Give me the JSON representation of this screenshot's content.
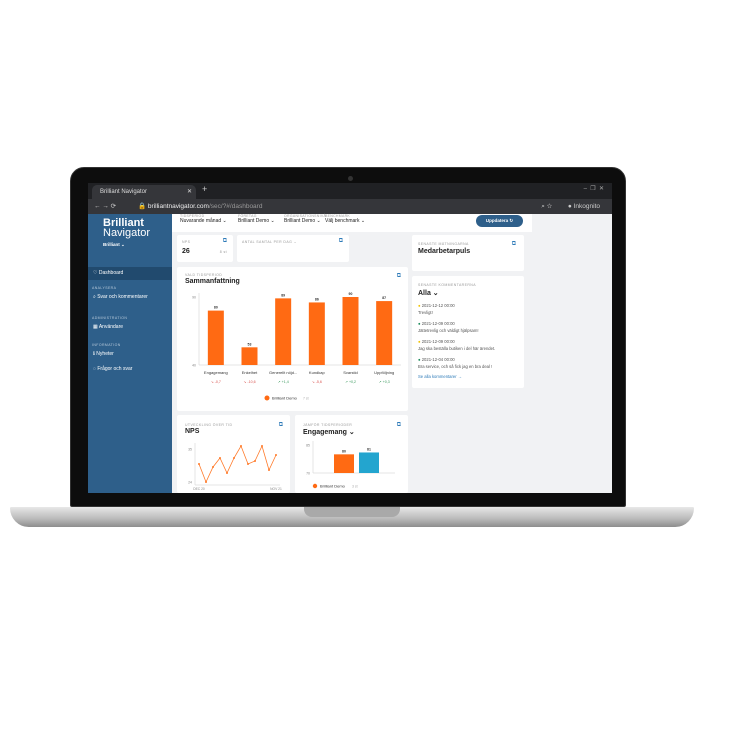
{
  "browser": {
    "tab_title": "Brilliant Navigator",
    "new_tab": "+",
    "url": "brilliantnavigator.com",
    "url_path": "/sec/?#/dashboard",
    "profile": "Inkognito"
  },
  "sidebar": {
    "logo_line1": "Brilliant",
    "logo_line2": "Navigator",
    "org": "Brilliant ⌄",
    "items": [
      {
        "label": "Dashboard",
        "icon": "heart-icon"
      },
      {
        "section": "ANALYSERA"
      },
      {
        "label": "Svar och kommentarer",
        "icon": "search-icon"
      },
      {
        "section": "ADMINISTRATION"
      },
      {
        "label": "Användare",
        "icon": "users-icon"
      },
      {
        "section": "INFORMATION"
      },
      {
        "label": "Nyheter",
        "icon": "info-icon"
      },
      {
        "label": "Frågor och svar",
        "icon": "chat-icon"
      }
    ]
  },
  "filters": [
    {
      "label": "TIDSPERIOD",
      "value": "Nuvarande månad ⌄"
    },
    {
      "label": "FÖRETAG",
      "value": "Brilliant Demo ⌄"
    },
    {
      "label": "ORGANISATIONSNIVÅ",
      "value": "Brilliant Demo ⌄"
    },
    {
      "label": "BENCHMARK",
      "value": "Välj benchmark ⌄"
    }
  ],
  "update_button": "Uppdatera ↻",
  "nps_card": {
    "label": "NPS",
    "value": "26",
    "sub": "8 st"
  },
  "antal_card": {
    "label": "ANTAL SAMTAL PER DAG ⌄"
  },
  "puls_card": {
    "label": "SENASTE MÄTNINGARNA",
    "title": "Medarbetarpuls"
  },
  "comments": {
    "label": "SENASTE KOMMENTARERNA",
    "title": "Alla ⌄",
    "items": [
      {
        "date": "2021-12-12 00:00",
        "text": "Trevligt!",
        "color": "#f2c300"
      },
      {
        "date": "2021-12-09 00:00",
        "text": "Jättetrevlig och väldigt hjälpsam!",
        "color": "#1b8a5a"
      },
      {
        "date": "2021-12-09 00:00",
        "text": "Jag ska beställa butiken i del här ärendet.",
        "color": "#f2c300"
      },
      {
        "date": "2021-12-04 00:00",
        "text": "Bra service, och så fick jag en bra deal !",
        "color": "#1b8a5a"
      }
    ],
    "more": "Se alla kommentarer →"
  },
  "chart_data": [
    {
      "type": "bar",
      "label": "VALD TIDSPERIOD",
      "title": "Sammanfattning",
      "categories": [
        "Engagemang",
        "Enkelhet",
        "Generellt nöjd...",
        "Kundkap",
        "Svarstid",
        "Uppföljning"
      ],
      "values": [
        80,
        53,
        89,
        86,
        90,
        87
      ],
      "changes": [
        "↘ -0,7",
        "↘ -10,6",
        "↗ +1,4",
        "↘ -5,6",
        "↗ +0,2",
        "↗ +0,3"
      ],
      "change_colors": [
        "#d9534f",
        "#d9534f",
        "#3c9a5f",
        "#d9534f",
        "#3c9a5f",
        "#3c9a5f"
      ],
      "yticks": [
        40,
        90
      ],
      "ylim": [
        40,
        90
      ],
      "legend": "Brilliant Demo",
      "legend_sub": "7 st",
      "color": "#ff6a13"
    },
    {
      "type": "line",
      "label": "UTVECKLING ÖVER TID",
      "title": "NPS",
      "values": [
        30,
        24,
        29,
        32,
        27,
        32,
        36,
        30,
        31,
        36,
        28,
        33
      ],
      "yticks": [
        24,
        35
      ],
      "ylim": [
        23,
        37
      ],
      "xlabels": [
        "DEC 20",
        "NOV 21"
      ],
      "color": "#ff7a2a"
    },
    {
      "type": "bar",
      "label": "JÄMFÖR TIDSPERIODER",
      "title": "Engagemang ⌄",
      "values": [
        80,
        81
      ],
      "colors": [
        "#ff6a13",
        "#23a5cf"
      ],
      "yticks": [
        70,
        85
      ],
      "ylim": [
        70,
        85
      ],
      "legend": "Brilliant Demo",
      "legend_sub": "3 st"
    }
  ]
}
